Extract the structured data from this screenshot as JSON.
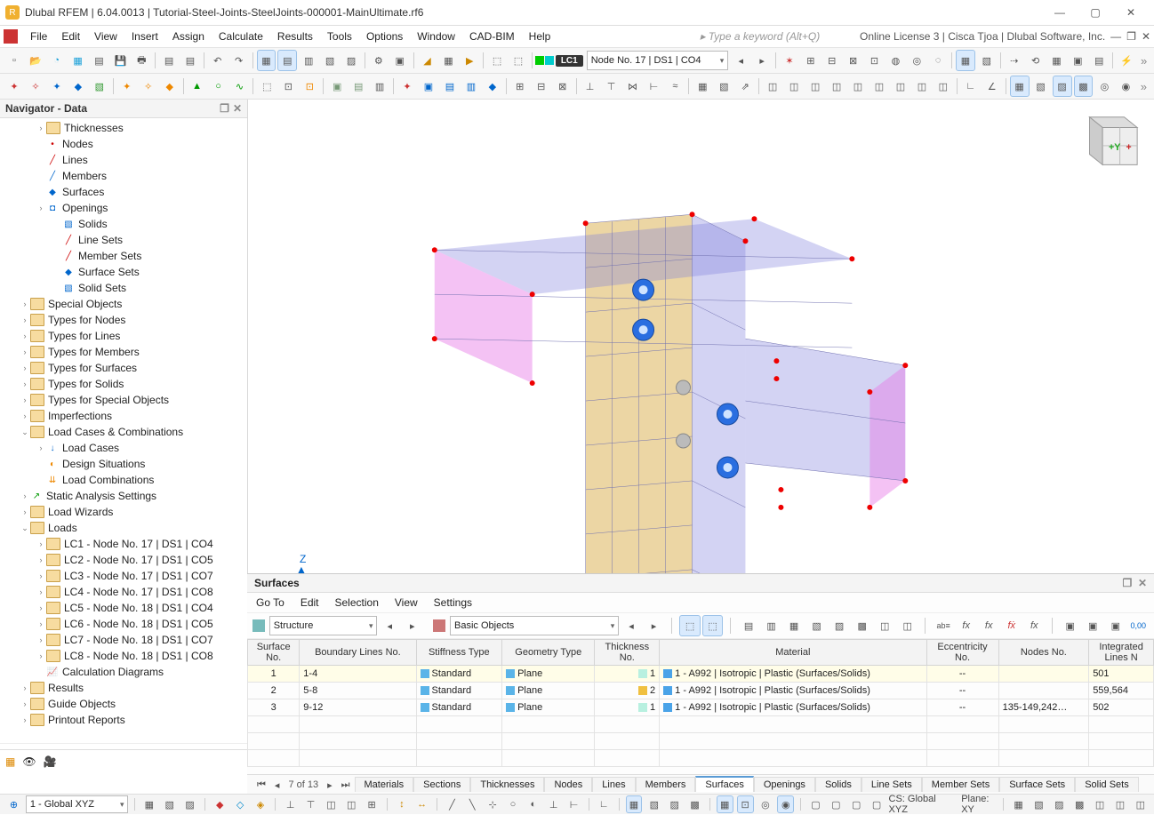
{
  "title": "Dlubal RFEM | 6.04.0013 | Tutorial-Steel-Joints-SteelJoints-000001-MainUltimate.rf6",
  "menus": [
    "File",
    "Edit",
    "View",
    "Insert",
    "Assign",
    "Calculate",
    "Results",
    "Tools",
    "Options",
    "Window",
    "CAD-BIM",
    "Help"
  ],
  "search_placeholder": "Type a keyword (Alt+Q)",
  "license": "Online License 3 | Cisca Tjoa | Dlubal Software, Inc.",
  "toolbar1": {
    "lc_tag": "LC1",
    "lc_combo": "Node No. 17 | DS1 | CO4"
  },
  "navigator": {
    "title": "Navigator - Data",
    "tree": [
      {
        "d": 2,
        "caret": ">",
        "label": "Thicknesses",
        "fold": true
      },
      {
        "d": 2,
        "caret": "",
        "label": "Nodes",
        "icon": "•",
        "iconClass": "red"
      },
      {
        "d": 2,
        "caret": "",
        "label": "Lines",
        "icon": "╱",
        "iconClass": "red"
      },
      {
        "d": 2,
        "caret": "",
        "label": "Members",
        "icon": "╱",
        "iconClass": "blue"
      },
      {
        "d": 2,
        "caret": "",
        "label": "Surfaces",
        "icon": "◆",
        "iconClass": "blue"
      },
      {
        "d": 2,
        "caret": ">",
        "label": "Openings",
        "icon": "◘",
        "iconClass": "blue",
        "box": true
      },
      {
        "d": 3,
        "caret": "",
        "label": "Solids",
        "icon": "▧",
        "iconClass": "blue"
      },
      {
        "d": 3,
        "caret": "",
        "label": "Line Sets",
        "icon": "╱",
        "iconClass": "red"
      },
      {
        "d": 3,
        "caret": "",
        "label": "Member Sets",
        "icon": "╱",
        "iconClass": "red"
      },
      {
        "d": 3,
        "caret": "",
        "label": "Surface Sets",
        "icon": "◆",
        "iconClass": "blue"
      },
      {
        "d": 3,
        "caret": "",
        "label": "Solid Sets",
        "icon": "▧",
        "iconClass": "blue"
      },
      {
        "d": 1,
        "caret": ">",
        "label": "Special Objects",
        "fold": true
      },
      {
        "d": 1,
        "caret": ">",
        "label": "Types for Nodes",
        "fold": true
      },
      {
        "d": 1,
        "caret": ">",
        "label": "Types for Lines",
        "fold": true
      },
      {
        "d": 1,
        "caret": ">",
        "label": "Types for Members",
        "fold": true
      },
      {
        "d": 1,
        "caret": ">",
        "label": "Types for Surfaces",
        "fold": true
      },
      {
        "d": 1,
        "caret": ">",
        "label": "Types for Solids",
        "fold": true
      },
      {
        "d": 1,
        "caret": ">",
        "label": "Types for Special Objects",
        "fold": true
      },
      {
        "d": 1,
        "caret": ">",
        "label": "Imperfections",
        "fold": true
      },
      {
        "d": 1,
        "caret": "v",
        "label": "Load Cases & Combinations",
        "fold": true
      },
      {
        "d": 2,
        "caret": ">",
        "label": "Load Cases",
        "icon": "↓",
        "iconClass": "blue"
      },
      {
        "d": 2,
        "caret": "",
        "label": "Design Situations",
        "icon": "◐",
        "iconClass": "orange"
      },
      {
        "d": 2,
        "caret": "",
        "label": "Load Combinations",
        "icon": "⇊",
        "iconClass": "orange"
      },
      {
        "d": 1,
        "caret": ">",
        "label": "Static Analysis Settings",
        "icon": "↗",
        "iconClass": "green"
      },
      {
        "d": 1,
        "caret": ">",
        "label": "Load Wizards",
        "fold": true
      },
      {
        "d": 1,
        "caret": "v",
        "label": "Loads",
        "fold": true
      },
      {
        "d": 2,
        "caret": ">",
        "label": "LC1 - Node No. 17 | DS1 | CO4",
        "fold": true
      },
      {
        "d": 2,
        "caret": ">",
        "label": "LC2 - Node No. 17 | DS1 | CO5",
        "fold": true
      },
      {
        "d": 2,
        "caret": ">",
        "label": "LC3 - Node No. 17 | DS1 | CO7",
        "fold": true
      },
      {
        "d": 2,
        "caret": ">",
        "label": "LC4 - Node No. 17 | DS1 | CO8",
        "fold": true
      },
      {
        "d": 2,
        "caret": ">",
        "label": "LC5 - Node No. 18 | DS1 | CO4",
        "fold": true
      },
      {
        "d": 2,
        "caret": ">",
        "label": "LC6 - Node No. 18 | DS1 | CO5",
        "fold": true
      },
      {
        "d": 2,
        "caret": ">",
        "label": "LC7 - Node No. 18 | DS1 | CO7",
        "fold": true
      },
      {
        "d": 2,
        "caret": ">",
        "label": "LC8 - Node No. 18 | DS1 | CO8",
        "fold": true
      },
      {
        "d": 2,
        "caret": "",
        "label": "Calculation Diagrams",
        "icon": "📈",
        "iconClass": ""
      },
      {
        "d": 1,
        "caret": ">",
        "label": "Results",
        "fold": true
      },
      {
        "d": 1,
        "caret": ">",
        "label": "Guide Objects",
        "fold": true
      },
      {
        "d": 1,
        "caret": ">",
        "label": "Printout Reports",
        "fold": true
      }
    ]
  },
  "surfaces": {
    "title": "Surfaces",
    "menus": [
      "Go To",
      "Edit",
      "Selection",
      "View",
      "Settings"
    ],
    "combo1": "Structure",
    "combo2": "Basic Objects",
    "headers": [
      "Surface\nNo.",
      "Boundary Lines No.",
      "Stiffness Type",
      "Geometry Type",
      "Thickness\nNo.",
      "Material",
      "Eccentricity\nNo.",
      "Nodes No.",
      "Integrated\nLines N"
    ],
    "rows": [
      {
        "no": "1",
        "lines": "1-4",
        "stiff": "Standard",
        "geom": "Plane",
        "thk": "1",
        "thkColor": "#b8f0e0",
        "mat": "1 - A992 | Isotropic | Plastic (Surfaces/Solids)",
        "matColor": "#4aa3e8",
        "ecc": "--",
        "nodes": "",
        "integ": "501",
        "sel": true
      },
      {
        "no": "2",
        "lines": "5-8",
        "stiff": "Standard",
        "geom": "Plane",
        "thk": "2",
        "thkColor": "#f0c040",
        "mat": "1 - A992 | Isotropic | Plastic (Surfaces/Solids)",
        "matColor": "#4aa3e8",
        "ecc": "--",
        "nodes": "",
        "integ": "559,564"
      },
      {
        "no": "3",
        "lines": "9-12",
        "stiff": "Standard",
        "geom": "Plane",
        "thk": "1",
        "thkColor": "#b8f0e0",
        "mat": "1 - A992 | Isotropic | Plastic (Surfaces/Solids)",
        "matColor": "#4aa3e8",
        "ecc": "--",
        "nodes": "135-149,242…",
        "integ": "502"
      }
    ],
    "page": "7 of 13",
    "tabs": [
      "Materials",
      "Sections",
      "Thicknesses",
      "Nodes",
      "Lines",
      "Members",
      "Surfaces",
      "Openings",
      "Solids",
      "Line Sets",
      "Member Sets",
      "Surface Sets",
      "Solid Sets"
    ],
    "activeTab": "Surfaces"
  },
  "status": {
    "cs_combo": "1 - Global XYZ",
    "cs": "CS: Global XYZ",
    "plane": "Plane: XY"
  }
}
